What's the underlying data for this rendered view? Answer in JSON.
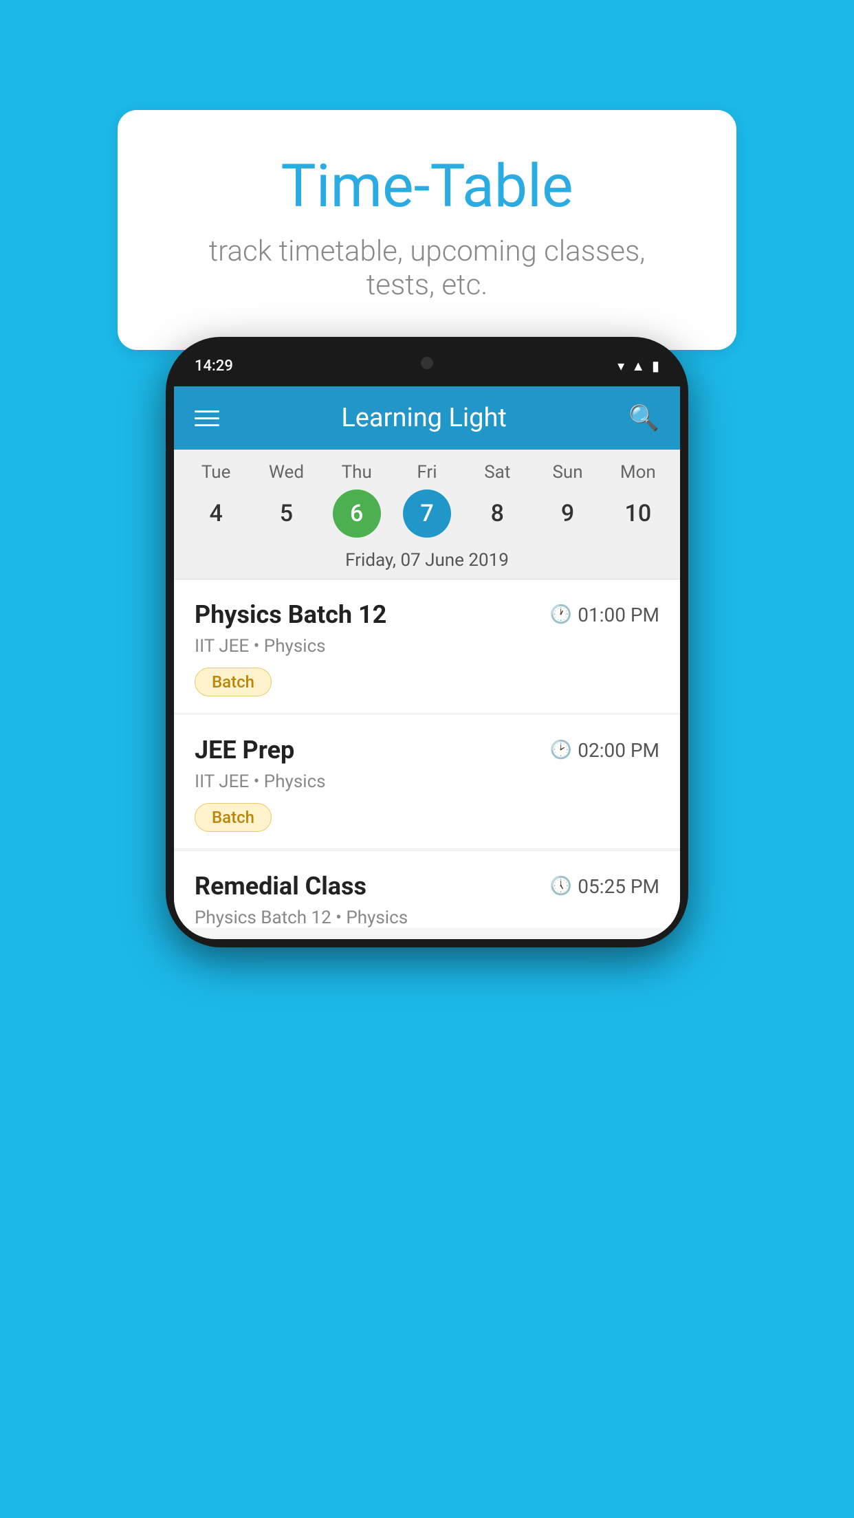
{
  "background_color": "#1CB8E8",
  "speech_bubble": {
    "title": "Time-Table",
    "subtitle": "track timetable, upcoming classes, tests, etc."
  },
  "phone": {
    "status_bar": {
      "time": "14:29"
    },
    "app_bar": {
      "title": "Learning Light"
    },
    "calendar": {
      "days": [
        {
          "name": "Tue",
          "num": "4",
          "state": "normal"
        },
        {
          "name": "Wed",
          "num": "5",
          "state": "normal"
        },
        {
          "name": "Thu",
          "num": "6",
          "state": "today"
        },
        {
          "name": "Fri",
          "num": "7",
          "state": "selected"
        },
        {
          "name": "Sat",
          "num": "8",
          "state": "normal"
        },
        {
          "name": "Sun",
          "num": "9",
          "state": "normal"
        },
        {
          "name": "Mon",
          "num": "10",
          "state": "normal"
        }
      ],
      "selected_date_label": "Friday, 07 June 2019"
    },
    "classes": [
      {
        "name": "Physics Batch 12",
        "time": "01:00 PM",
        "detail": "IIT JEE • Physics",
        "badge": "Batch"
      },
      {
        "name": "JEE Prep",
        "time": "02:00 PM",
        "detail": "IIT JEE • Physics",
        "badge": "Batch"
      },
      {
        "name": "Remedial Class",
        "time": "05:25 PM",
        "detail": "Physics Batch 12 • Physics",
        "badge": null
      }
    ]
  }
}
